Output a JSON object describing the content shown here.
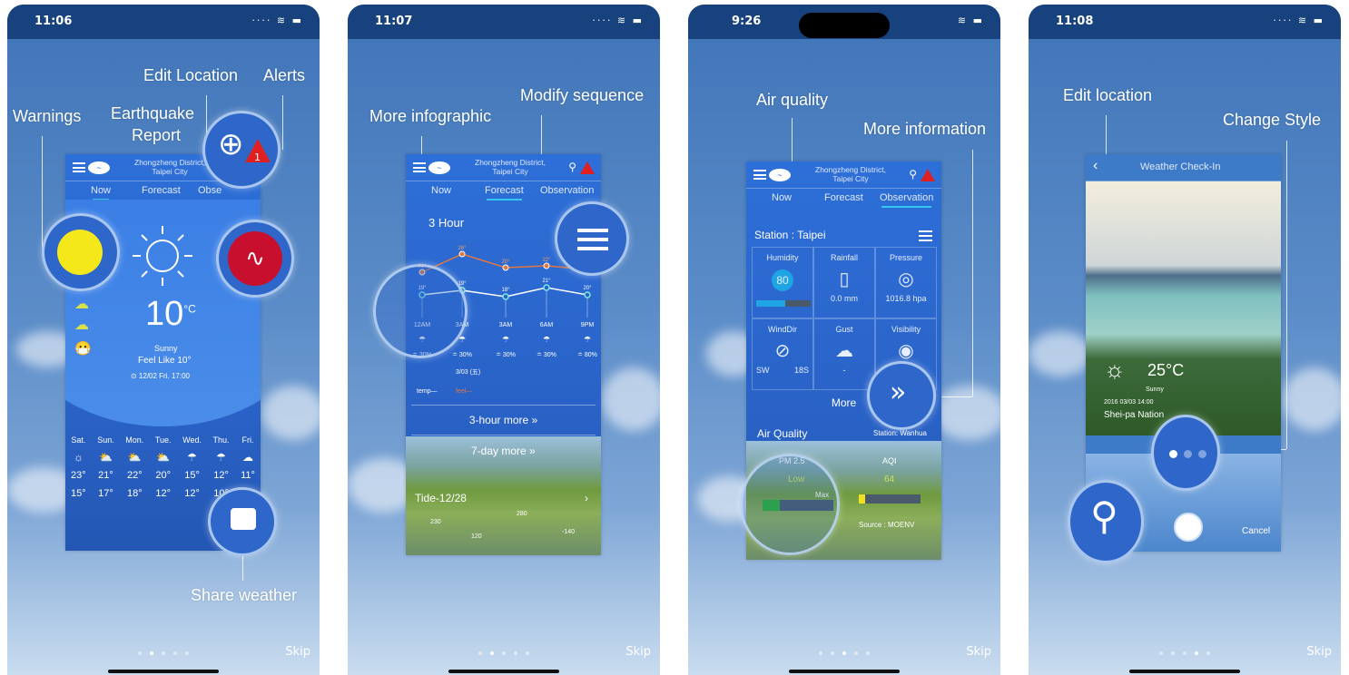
{
  "panels": [
    {
      "time": "11:06",
      "callouts": {
        "edit_location": "Edit  Location",
        "alerts": "Alerts",
        "warnings": "Warnings",
        "earthquake": "Earthquake",
        "report": "Report",
        "share": "Share weather"
      },
      "app": {
        "location_line1": "Zhongzheng District,",
        "location_line2": "Taipei City",
        "tabs": [
          "Now",
          "Forecast",
          "Obse"
        ],
        "temp": "10",
        "unit": "°C",
        "condition": "Sunny",
        "feel_like": "Feel Like 10°",
        "updated": "⊙ 12/02  Fri.  17:00",
        "alert_count": "1",
        "week": [
          {
            "day": "Sat.",
            "hi": "23°",
            "lo": "15°",
            "icon": "sun"
          },
          {
            "day": "Sun.",
            "hi": "21°",
            "lo": "17°",
            "icon": "partly-cloudy"
          },
          {
            "day": "Mon.",
            "hi": "22°",
            "lo": "18°",
            "icon": "partly-cloudy"
          },
          {
            "day": "Tue.",
            "hi": "20°",
            "lo": "12°",
            "icon": "sun-cloud"
          },
          {
            "day": "Wed.",
            "hi": "15°",
            "lo": "12°",
            "icon": "rain"
          },
          {
            "day": "Thu.",
            "hi": "12°",
            "lo": "10°",
            "icon": "rain"
          },
          {
            "day": "Fri.",
            "hi": "11°",
            "lo": "",
            "icon": "cloud"
          }
        ]
      },
      "skip": "Skip",
      "page": 1
    },
    {
      "time": "11:07",
      "callouts": {
        "more_infographic": "More infographic",
        "modify_sequence": "Modify sequence"
      },
      "app": {
        "location_line1": "Zhongzheng District,",
        "location_line2": "Taipei City",
        "tabs": [
          "Now",
          "Forecast",
          "Observation"
        ],
        "section": "3 Hour",
        "hours": [
          {
            "label": "12AM",
            "feel": "21°",
            "temp": "19°",
            "rain": "30%"
          },
          {
            "label": "3AM",
            "feel": "26°",
            "temp": "19°",
            "rain": "30%"
          },
          {
            "label": "3AM",
            "feel": "20°",
            "temp": "18°",
            "rain": "30%"
          },
          {
            "label": "6AM",
            "feel": "22°",
            "temp": "21°",
            "rain": "30%"
          },
          {
            "label": "9PM",
            "feel": "",
            "temp": "20°",
            "rain": "80%"
          }
        ],
        "date": "3/03 (五)",
        "legend_temp": "temp—",
        "legend_feel": "feel—",
        "more_3h": "3-hour more  »",
        "more_7d": "7-day more  »",
        "tide": "Tide-12/28",
        "tide_values": [
          "230",
          "120",
          "280",
          "-140"
        ]
      },
      "skip": "Skip",
      "page": 1
    },
    {
      "time": "9:26",
      "callouts": {
        "air_quality": "Air quality",
        "more_information": "More information"
      },
      "app": {
        "location_line1": "Zhongzheng District,",
        "location_line2": "Taipei City",
        "tabs": [
          "Now",
          "Forecast",
          "Observation"
        ],
        "station": "Station : Taipei",
        "cells": [
          {
            "label": "Humidity",
            "value": "80",
            "unit": "%"
          },
          {
            "label": "Rainfall",
            "value": "0.0 mm"
          },
          {
            "label": "Pressure",
            "value": "1016.8 hpa"
          },
          {
            "label": "WindDir",
            "value": "SW",
            "value2": "18S"
          },
          {
            "label": "Gust",
            "value": "-"
          },
          {
            "label": "Visibility",
            "value": ""
          }
        ],
        "humidity_pct": 80,
        "more": "More",
        "air_quality": "Air Quality",
        "aq_station": "Station: Wanhua",
        "pm_label": "PM 2.5",
        "pm_level": "Low",
        "max": "Max",
        "aqi_label": "AQI",
        "aqi_value": "64",
        "source": "Source : MOENV"
      },
      "skip": "Skip",
      "page": 2
    },
    {
      "time": "11:08",
      "callouts": {
        "edit_location": "Edit location",
        "change_style": "Change Style"
      },
      "app": {
        "title": "Weather Check-In",
        "temp": "25°C",
        "condition": "Sunny",
        "datetime": "2016 03/03 14:00",
        "place": "Shei-pa Nation",
        "cancel": "Cancel"
      },
      "skip": "Skip",
      "page": 3
    }
  ],
  "colors": {
    "status_bar": "#17427e",
    "card": "#2a63c8",
    "accent": "#35c6f0",
    "alert": "#e02020",
    "temp_line": "#ffffff",
    "feel_line": "#e07840"
  }
}
